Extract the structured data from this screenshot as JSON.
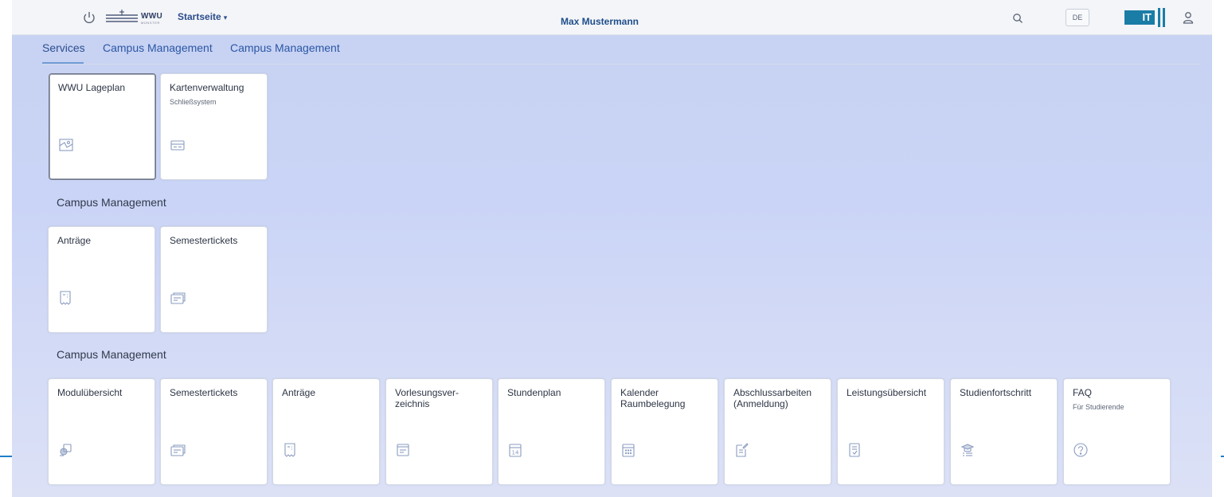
{
  "shellbar": {
    "logo_text": "WWU",
    "logo_subtext": "MÜNSTER",
    "home_label": "Startseite",
    "home_caret": "▾",
    "user_name": "Max Mustermann",
    "language": "DE",
    "it_logo_text": "IT"
  },
  "tabs": [
    {
      "label": "Services",
      "active": true
    },
    {
      "label": "Campus Management",
      "active": false
    },
    {
      "label": "Campus Management",
      "active": false
    }
  ],
  "sections": [
    {
      "title": "",
      "tiles": [
        {
          "title": "WWU Lageplan",
          "subtitle": "",
          "icon": "map-icon"
        },
        {
          "title": "Kartenverwaltung",
          "subtitle": "Schließsystem",
          "icon": "card-icon"
        }
      ]
    },
    {
      "title": "Campus Management",
      "tiles": [
        {
          "title": "Anträge",
          "subtitle": "",
          "icon": "receipt-icon"
        },
        {
          "title": "Semestertickets",
          "subtitle": "",
          "icon": "ticket-icon"
        }
      ]
    },
    {
      "title": "Campus Management",
      "tiles": [
        {
          "title": "Modulübersicht",
          "subtitle": "",
          "icon": "module-icon"
        },
        {
          "title": "Semestertickets",
          "subtitle": "",
          "icon": "ticket-icon"
        },
        {
          "title": "Anträge",
          "subtitle": "",
          "icon": "receipt-icon"
        },
        {
          "title": "Vorlesungsver-\nzeichnis",
          "subtitle": "",
          "icon": "course-list-icon"
        },
        {
          "title": "Stundenplan",
          "subtitle": "",
          "icon": "calendar-14-icon"
        },
        {
          "title": "Kalender\nRaumbelegung",
          "subtitle": "",
          "icon": "calendar-grid-icon"
        },
        {
          "title": "Abschlussarbeiten\n(Anmeldung)",
          "subtitle": "",
          "icon": "edit-document-icon"
        },
        {
          "title": "Leistungsübersicht",
          "subtitle": "",
          "icon": "checked-document-icon"
        },
        {
          "title": "Studienfortschritt",
          "subtitle": "",
          "icon": "graduation-icon"
        },
        {
          "title": "FAQ",
          "subtitle": "Für Studierende",
          "icon": "question-icon"
        }
      ]
    }
  ],
  "colors": {
    "accent": "#2b57a5",
    "background": "#c7d2f2",
    "it_brand": "#1a7da6"
  }
}
